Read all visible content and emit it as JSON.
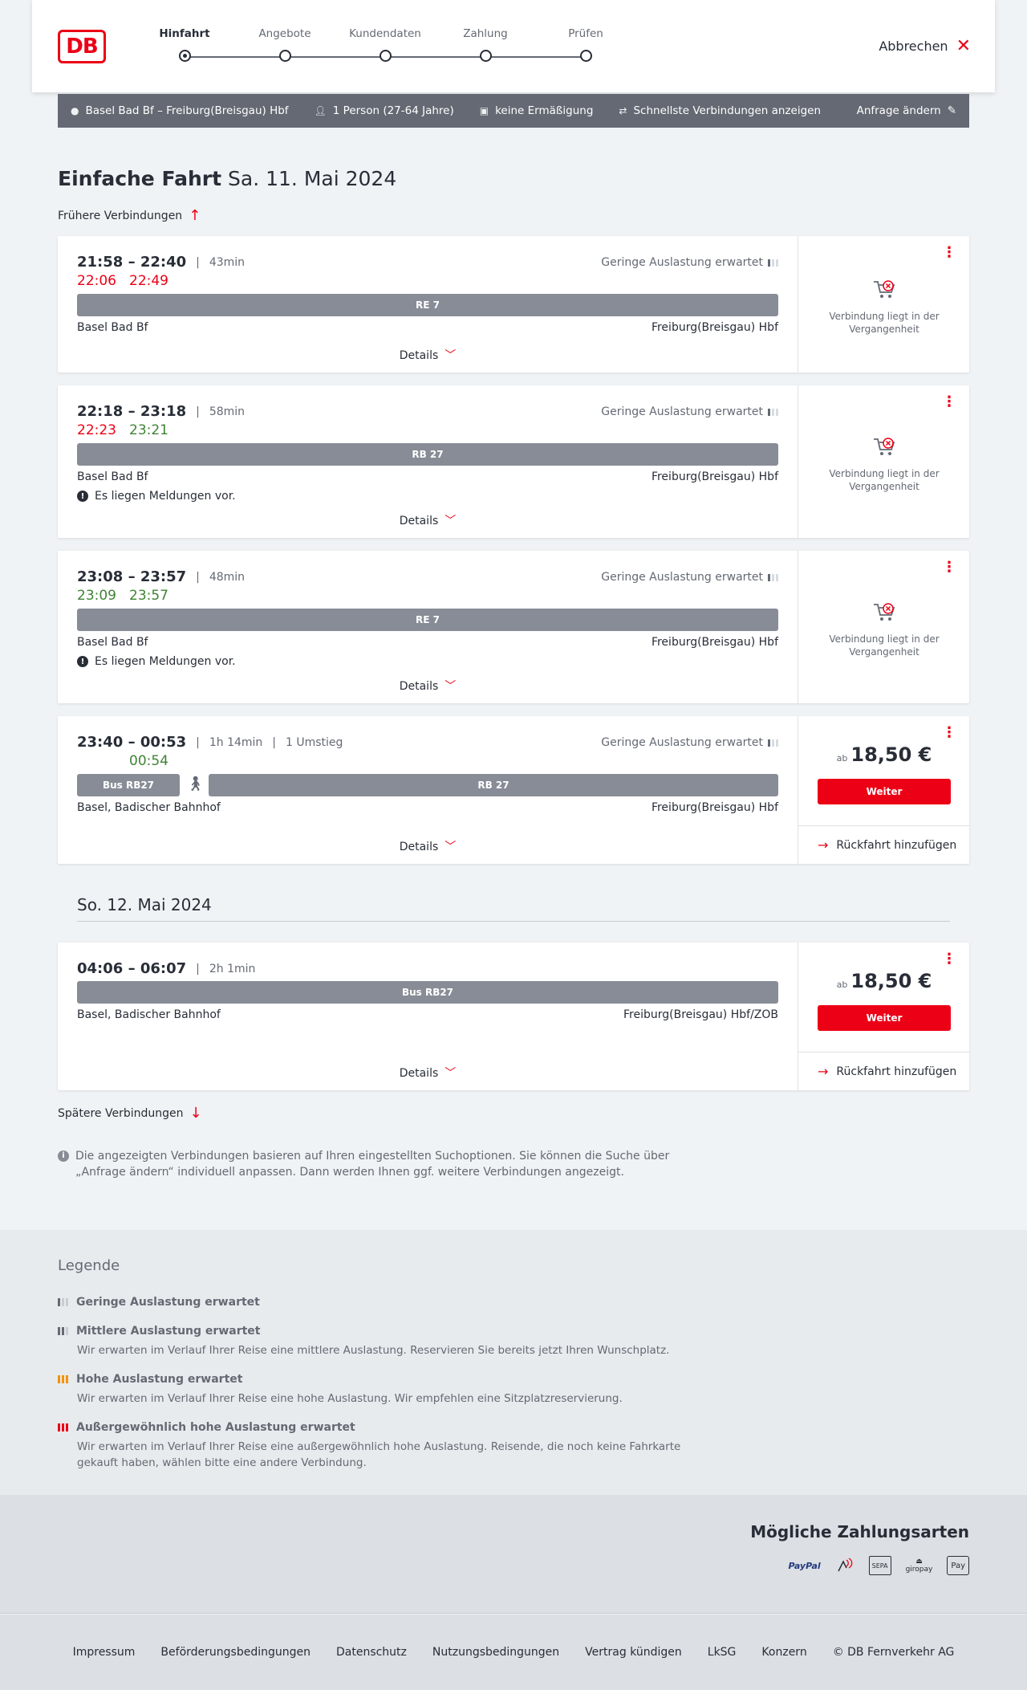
{
  "header": {
    "logo": "DB",
    "steps": [
      "Hinfahrt",
      "Angebote",
      "Kundendaten",
      "Zahlung",
      "Prüfen"
    ],
    "cancel_label": "Abbrechen"
  },
  "summary": {
    "route": "Basel Bad Bf – Freiburg(Breisgau) Hbf",
    "persons": "1 Person (27-64 Jahre)",
    "discount": "keine Ermäßigung",
    "fastest": "Schnellste Verbindungen anzeigen",
    "change": "Anfrage ändern"
  },
  "title": {
    "main": "Einfache Fahrt",
    "date": "Sa. 11. Mai 2024"
  },
  "earlier": "Frühere Verbindungen",
  "later": "Spätere Verbindungen",
  "day2": "So. 12. Mai 2024",
  "load_label": "Geringe Auslastung erwartet",
  "details_label": "Details",
  "past_label": "Verbindung liegt in der Vergangenheit",
  "messages_label": "Es liegen Meldungen vor.",
  "connections": [
    {
      "times": "21:58 – 22:40",
      "duration": "43min",
      "rt_dep": "22:06",
      "rt_arr": "22:49",
      "train": "RE 7",
      "from": "Basel Bad Bf",
      "to": "Freiburg(Breisgau) Hbf"
    },
    {
      "times": "22:18 – 23:18",
      "duration": "58min",
      "rt_dep": "22:23",
      "rt_arr": "23:21",
      "train": "RB 27",
      "from": "Basel Bad Bf",
      "to": "Freiburg(Breisgau) Hbf"
    },
    {
      "times": "23:08 – 23:57",
      "duration": "48min",
      "rt_dep": "23:09",
      "rt_arr": "23:57",
      "train": "RE 7",
      "from": "Basel Bad Bf",
      "to": "Freiburg(Breisgau) Hbf"
    },
    {
      "times": "23:40 – 00:53",
      "duration": "1h 14min",
      "transfers": "1 Umstieg",
      "rt_arr": "00:54",
      "train1": "Bus RB27",
      "train2": "RB 27",
      "from": "Basel, Badischer Bahnhof",
      "to": "Freiburg(Breisgau) Hbf",
      "price_prefix": "ab",
      "price": "18,50 €",
      "next": "Weiter",
      "return": "Rückfahrt hinzufügen"
    },
    {
      "times": "04:06 – 06:07",
      "duration": "2h 1min",
      "train": "Bus RB27",
      "from": "Basel, Badischer Bahnhof",
      "to": "Freiburg(Breisgau) Hbf/ZOB",
      "price_prefix": "ab",
      "price": "18,50 €",
      "next": "Weiter",
      "return": "Rückfahrt hinzufügen"
    }
  ],
  "note": "Die angezeigten Verbindungen basieren auf Ihren eingestellten Suchoptionen. Sie können die Suche über „Anfrage ändern“ individuell anpassen. Dann werden Ihnen ggf. weitere Verbindungen angezeigt.",
  "legend": {
    "title": "Legende",
    "items": [
      {
        "title": "Geringe Auslastung erwartet",
        "desc": "",
        "color": "#646973"
      },
      {
        "title": "Mittlere Auslastung erwartet",
        "desc": "Wir erwarten im Verlauf Ihrer Reise eine mittlere Auslastung. Reservieren Sie bereits jetzt Ihren Wunschplatz.",
        "color": "#646973"
      },
      {
        "title": "Hohe Auslastung erwartet",
        "desc": "Wir erwarten im Verlauf Ihrer Reise eine hohe Auslastung. Wir empfehlen eine Sitzplatzreservierung.",
        "color": "#f39200"
      },
      {
        "title": "Außergewöhnlich hohe Auslastung erwartet",
        "desc": "Wir erwarten im Verlauf Ihrer Reise eine außergewöhnlich hohe Auslastung. Reisende, die noch keine Fahrkarte gekauft haben, wählen bitte eine andere Verbindung.",
        "color": "#ec0016"
      }
    ]
  },
  "payments": {
    "title": "Mögliche Zahlungsarten",
    "methods": [
      "PayPal",
      "SEPA",
      "giropay",
      "Pay"
    ]
  },
  "footer": [
    "Impressum",
    "Beförderungsbedingungen",
    "Datenschutz",
    "Nutzungsbedingungen",
    "Vertrag kündigen",
    "LkSG",
    "Konzern",
    "© DB Fernverkehr AG"
  ],
  "colors": {
    "brand_red": "#ec0016",
    "delay_red": "#ec0016",
    "ontime_green": "#408335",
    "train_bar": "#878c96"
  }
}
